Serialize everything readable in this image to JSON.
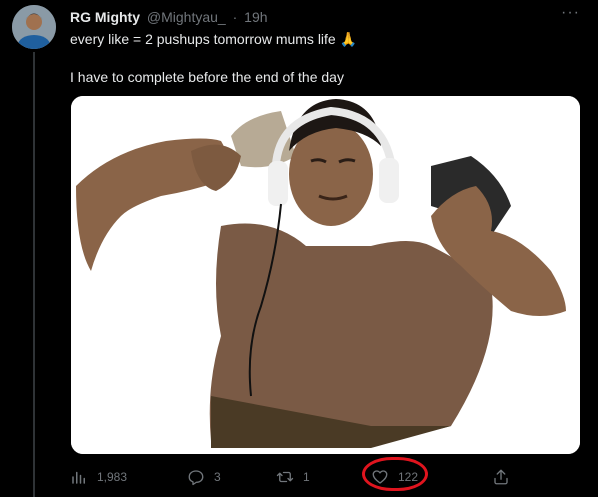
{
  "tweet": {
    "display_name": "RG Mighty",
    "handle": "@Mightyau_",
    "separator": "·",
    "time": "19h",
    "more_label": "···",
    "text_line1": "every like = 2 pushups tomorrow mums life 🙏",
    "text_line2": "I have to complete before the end of the day"
  },
  "actions": {
    "views": "1,983",
    "replies": "3",
    "retweets": "1",
    "likes": "122"
  },
  "colors": {
    "background": "#000000",
    "text": "#e7e9ea",
    "muted": "#71767b",
    "highlight": "#e0141e"
  },
  "icons": [
    "analytics-icon",
    "reply-icon",
    "retweet-icon",
    "heart-icon",
    "share-icon",
    "more-icon"
  ]
}
